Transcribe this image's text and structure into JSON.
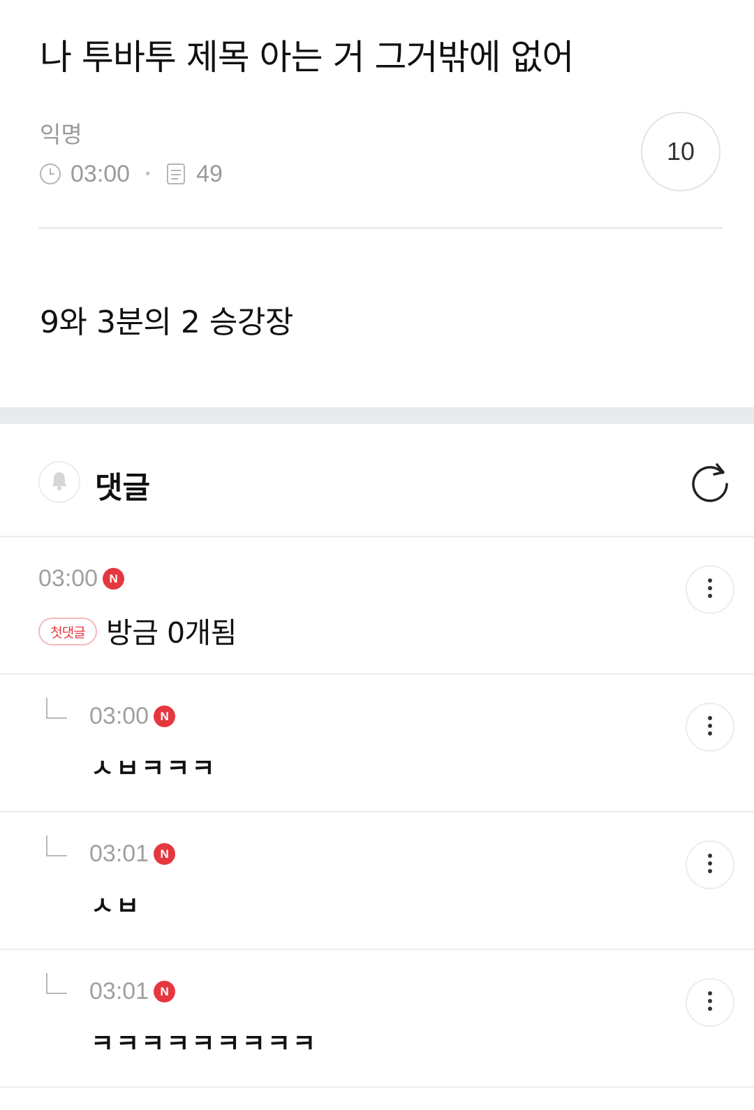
{
  "post": {
    "title": "나 투바투 제목 아는 거 그거밖에 없어",
    "author": "익명",
    "time": "03:00",
    "views": "49",
    "like_count": "10",
    "body": "9와 3분의 2 승강장"
  },
  "comments_section": {
    "title": "댓글"
  },
  "comments": [
    {
      "time": "03:00",
      "new_badge": "N",
      "first_badge": "첫댓글",
      "text": "방금 0개됨"
    },
    {
      "time": "03:00",
      "new_badge": "N",
      "text": "ㅅㅂㅋㅋㅋ"
    },
    {
      "time": "03:01",
      "new_badge": "N",
      "text": "ㅅㅂ"
    },
    {
      "time": "03:01",
      "new_badge": "N",
      "text": "ㅋㅋㅋㅋㅋㅋㅋㅋㅋ"
    }
  ],
  "colors": {
    "accent_red": "#e5373f",
    "muted_text": "#9a9a9a",
    "divider": "#ececec",
    "section_gap": "#e9eaec"
  },
  "icons": {
    "time": "clock-icon",
    "views": "document-icon",
    "notification": "bell-icon",
    "refresh": "refresh-icon",
    "more": "more-vertical-icon",
    "reply": "reply-arrow-icon"
  }
}
